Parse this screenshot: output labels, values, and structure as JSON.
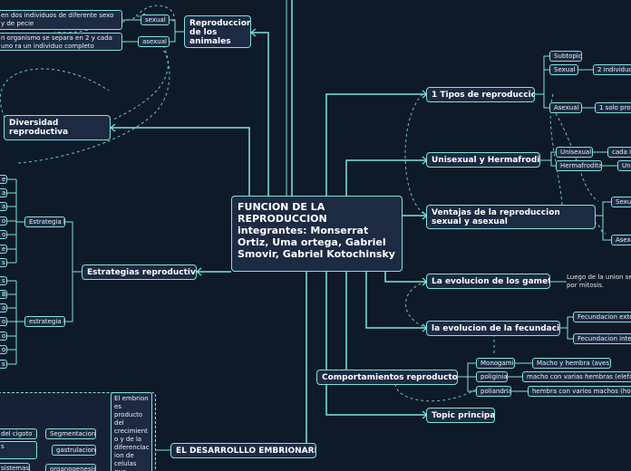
{
  "central": {
    "text": "FUNCION DE LA REPRODUCCION integrantes: Monserrat Ortiz, Uma ortega, Gabriel Smovir, Gabriel Kotochinsky"
  },
  "left": {
    "reproduccion_animales": "Reproduccion de los animales",
    "sexual": "sexual",
    "asexual": "asexual",
    "sexual_note": "en dos individuos de diferente sexo y de pecie",
    "asexual_note": "n organismo se separa  en 2 y cada uno ra un individuo completo",
    "diversidad": "Diversidad reproductiva",
    "estrategias": "Estrategias reproductivas",
    "estrategia_k": "Estrategia k",
    "estrategia_r": "estrategia R",
    "k_items": [
      "e",
      "a",
      "a",
      "o",
      "o",
      "e",
      "s"
    ],
    "r_items": [
      "s",
      "B",
      "a",
      "o",
      "o",
      "o",
      "s"
    ],
    "desarrollo": "EL DESARROLLLO EMBRIONARIO",
    "embrion_note": "El embrion es producto del crecimient o y de la diferenciac ion de celulas que",
    "segmentacion": "Segmentacion",
    "gastrulacion": "gastrulacion",
    "organogenesis": "organogenesis",
    "cigoto_note": "del cigoto",
    "s_note": "s",
    "sistemas_note": "sistemas"
  },
  "right": {
    "tipos": "1 Tipos de reproduccion",
    "subtopic": "Subtopic",
    "sexual": "Sexual",
    "asexual": "Asexual",
    "dos_individuos": "2 individuos",
    "un_solo": "1 solo prog",
    "unisexual_hermafrodita": "Unisexual y Hermafrodita",
    "unisexual": "Unisexual",
    "hermafrodita": "Hermafrodita",
    "cada": "cada i",
    "un": "Un",
    "ventajas": "Ventajas de la reproduccion sexual y asexual",
    "v_sexual": "Sexu",
    "v_asexual": "Asex",
    "evolucion_gametos": "La evolucion de los gametos",
    "gametos_note": "Luego de la union se por mitosis.",
    "evolucion_fecundacion": "la evolucion de la fecundacion",
    "fec_externa": "Fecundacion exte",
    "fec_interna": "Fecundacion inter",
    "comportamientos": "Comportamientos reproductores",
    "monogamia": "Monogamia",
    "poliginia": "poliginia",
    "poliandria": "poliandria",
    "monogamia_note": "Macho y hembra (aves)",
    "poliginia_note": "macho con varias hembras (elefant",
    "poliandria_note": "hembra con varios machos (horm",
    "topic_principal": "Topic principal"
  }
}
